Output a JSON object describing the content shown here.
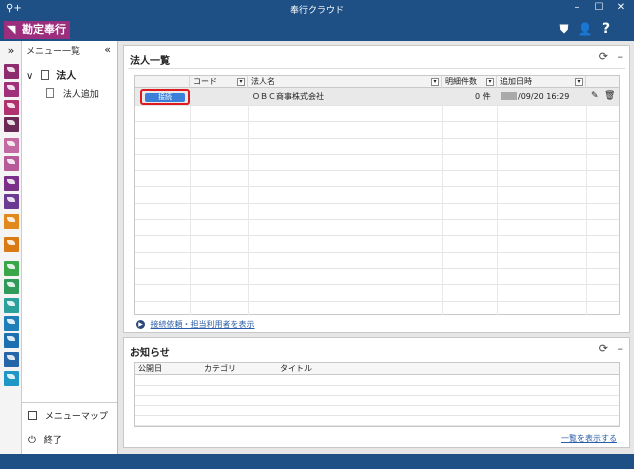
{
  "window": {
    "title": "奉行クラウド",
    "app_icon": "⚲+",
    "minimize": "–",
    "maximize": "☐",
    "close": "✕"
  },
  "appbar": {
    "brand": "勘定奉行",
    "brand_icon": "◥",
    "icons": {
      "shield": "⛊",
      "user": "👤",
      "help": "?"
    }
  },
  "colors": {
    "titlebar": "#1e4f85",
    "brand": "#9b2f7e",
    "connect_button": "#3b7fd9",
    "highlight": "#e0191e"
  },
  "tile_strip": {
    "expand": "»",
    "tiles": [
      "#8e2d6e",
      "#a0307a",
      "#b0336f",
      "#6a2a55",
      "#c46aa3",
      "#b65a98",
      "#7a2f88",
      "#6b3a92",
      "#e08a1e",
      "#d97a12",
      "#3aa64a",
      "#2f9a5a",
      "#2ca09a",
      "#1f7fb8",
      "#1d6fb0",
      "#2565a8",
      "#1f97c6"
    ]
  },
  "sidemenu": {
    "header": "メニュー一覧",
    "collapse": "«",
    "tree_toggle": "∨",
    "root_label": "法人",
    "child_label": "法人追加",
    "menu_map": "メニューマップ",
    "exit": "終了"
  },
  "corp_panel": {
    "title": "法人一覧",
    "refresh": "⟳",
    "minimize": "–",
    "columns": [
      "コード",
      "法人名",
      "明細件数",
      "追加日時"
    ],
    "row": {
      "button": "接続",
      "code": "",
      "name": "ＯＢＣ商事株式会社",
      "count": "0 件",
      "date": "/09/20 16:29",
      "edit_icon": "✎",
      "delete_icon": "🗑"
    },
    "footer_link": "接続依頼・担当利用者を表示"
  },
  "news_panel": {
    "title": "お知らせ",
    "refresh": "⟳",
    "minimize": "–",
    "columns": [
      "公開日",
      "カテゴリ",
      "タイトル"
    ],
    "footer_link": "一覧を表示する"
  }
}
